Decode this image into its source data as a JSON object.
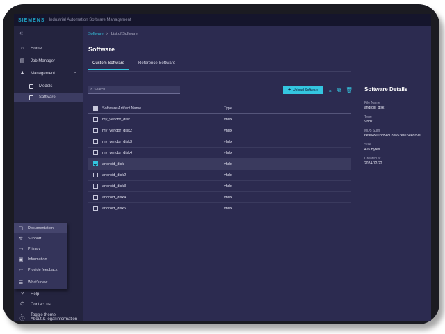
{
  "topbar": {
    "brand": "SIEMENS",
    "app_title": "Industrial Automation Software Management"
  },
  "sidebar": {
    "collapse_label": "«",
    "items": [
      {
        "label": "Home",
        "icon": "home-icon"
      },
      {
        "label": "Job Manager",
        "icon": "clipboard-icon"
      },
      {
        "label": "Management",
        "icon": "users-icon"
      }
    ],
    "sub_items": [
      {
        "label": "Models"
      },
      {
        "label": "Software"
      }
    ],
    "help_menu": [
      {
        "label": "Documentation",
        "icon": "document-icon"
      },
      {
        "label": "Support",
        "icon": "support-icon"
      },
      {
        "label": "Privacy",
        "icon": "lock-icon"
      },
      {
        "label": "Information",
        "icon": "info-card-icon"
      },
      {
        "label": "Provide feedback",
        "icon": "feedback-icon"
      },
      {
        "label": "What's new",
        "icon": "list-icon"
      }
    ],
    "bottom_items": [
      {
        "label": "Help",
        "icon": "help-icon"
      },
      {
        "label": "Contact us",
        "icon": "phone-icon"
      },
      {
        "label": "Toggle theme",
        "icon": "theme-icon"
      },
      {
        "label": "About & legal information",
        "icon": "info-icon"
      }
    ]
  },
  "breadcrumb": {
    "parent": "Software",
    "separator": ">",
    "current": "List of Software"
  },
  "page_title": "Software",
  "tabs": [
    "Custom Software",
    "Reference Software"
  ],
  "search": {
    "placeholder": "Search"
  },
  "toolbar": {
    "upload_label": "Upload Software",
    "plus": "+"
  },
  "table": {
    "columns": [
      "Software Artifact Name",
      "Type"
    ],
    "rows": [
      {
        "name": "my_vendor_disk",
        "type": "vhdx",
        "selected": false
      },
      {
        "name": "my_vendor_disk2",
        "type": "vhdx",
        "selected": false
      },
      {
        "name": "my_vendor_disk3",
        "type": "vhdx",
        "selected": false
      },
      {
        "name": "my_vendor_disk4",
        "type": "vhdx",
        "selected": false
      },
      {
        "name": "android_disk",
        "type": "vhdx",
        "selected": true
      },
      {
        "name": "android_disk2",
        "type": "vhdx",
        "selected": false
      },
      {
        "name": "android_disk3",
        "type": "vhdx",
        "selected": false
      },
      {
        "name": "android_disk4",
        "type": "vhdx",
        "selected": false
      },
      {
        "name": "android_disk5",
        "type": "vhdx",
        "selected": false
      }
    ]
  },
  "details": {
    "title": "Software Details",
    "fields": [
      {
        "label": "File Name",
        "value": "android_disk"
      },
      {
        "label": "Type",
        "value": "Vhdx"
      },
      {
        "label": "MD5 Sum",
        "value": "6e9045013d5ed03e652e615eeda9e"
      },
      {
        "label": "Size",
        "value": "426 Bytes"
      },
      {
        "label": "Created at",
        "value": "2024-12-22"
      }
    ]
  },
  "colors": {
    "accent": "#34c6e0",
    "background": "#2c2b50",
    "sidebar": "#24243f",
    "topbar": "#15152c"
  }
}
